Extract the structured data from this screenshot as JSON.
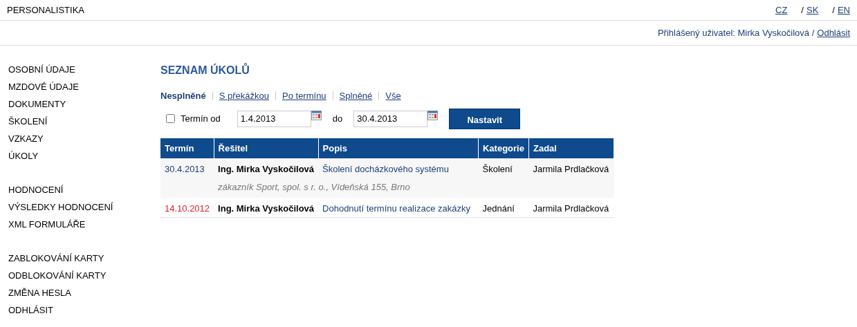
{
  "header": {
    "brand": "PERSONALISTIKA",
    "languages": [
      {
        "label": "CZ"
      },
      {
        "label": "SK",
        "separator": "/"
      },
      {
        "label": "EN",
        "separator": "/"
      }
    ]
  },
  "user_bar": {
    "text": "Přihlášený uživatel: Mirka Vyskočilová /",
    "logout": "Odhlásit"
  },
  "sidebar": {
    "groups": [
      {
        "items": [
          {
            "label": "OSOBNÍ ÚDAJE"
          },
          {
            "label": "MZDOVÉ ÚDAJE"
          },
          {
            "label": "DOKUMENTY"
          },
          {
            "label": "ŠKOLENÍ"
          },
          {
            "label": "VZKAZY"
          },
          {
            "label": "ÚKOLY"
          }
        ]
      },
      {
        "items": [
          {
            "label": "HODNOCENÍ"
          },
          {
            "label": "VÝSLEDKY HODNOCENÍ"
          },
          {
            "label": "XML FORMULÁŘE"
          }
        ]
      },
      {
        "items": [
          {
            "label": "ZABLOKOVÁNÍ KARTY"
          },
          {
            "label": "ODBLOKOVÁNÍ KARTY"
          },
          {
            "label": "ZMĚNA HESLA"
          },
          {
            "label": "ODHLÁSIT"
          }
        ]
      }
    ]
  },
  "page_title": "SEZNAM ÚKOLŮ",
  "filters": [
    {
      "label": "Nesplněné",
      "selected": true
    },
    {
      "label": "S překážkou",
      "selected": false
    },
    {
      "label": "Po termínu",
      "selected": false
    },
    {
      "label": "Splněné",
      "selected": false
    },
    {
      "label": "Vše",
      "selected": false
    }
  ],
  "date_filter": {
    "checked": false,
    "label": "Termín od",
    "from": "1.4.2013",
    "to_label": "do",
    "to": "30.4.2013",
    "button": "Nastavit"
  },
  "table": {
    "columns": [
      "Termín",
      "Řešitel",
      "Popis",
      "Kategorie",
      "Zadal"
    ],
    "rows": [
      {
        "date": "30.4.2013",
        "overdue": false,
        "assignee": "Ing. Mirka Vyskočilová",
        "description": "Školení docházkového systému",
        "category": "Školení",
        "assigned_by": "Jarmila Prdlačková",
        "note": "zákazník Sport, spol. s r. o., Vídeňská 155, Brno"
      },
      {
        "date": "14.10.2012",
        "overdue": true,
        "assignee": "Ing. Mirka Vyskočilová",
        "description": "Dohodnutí termínu realizace zakázky",
        "category": "Jednání",
        "assigned_by": "Jarmila Prdlačková"
      }
    ]
  }
}
